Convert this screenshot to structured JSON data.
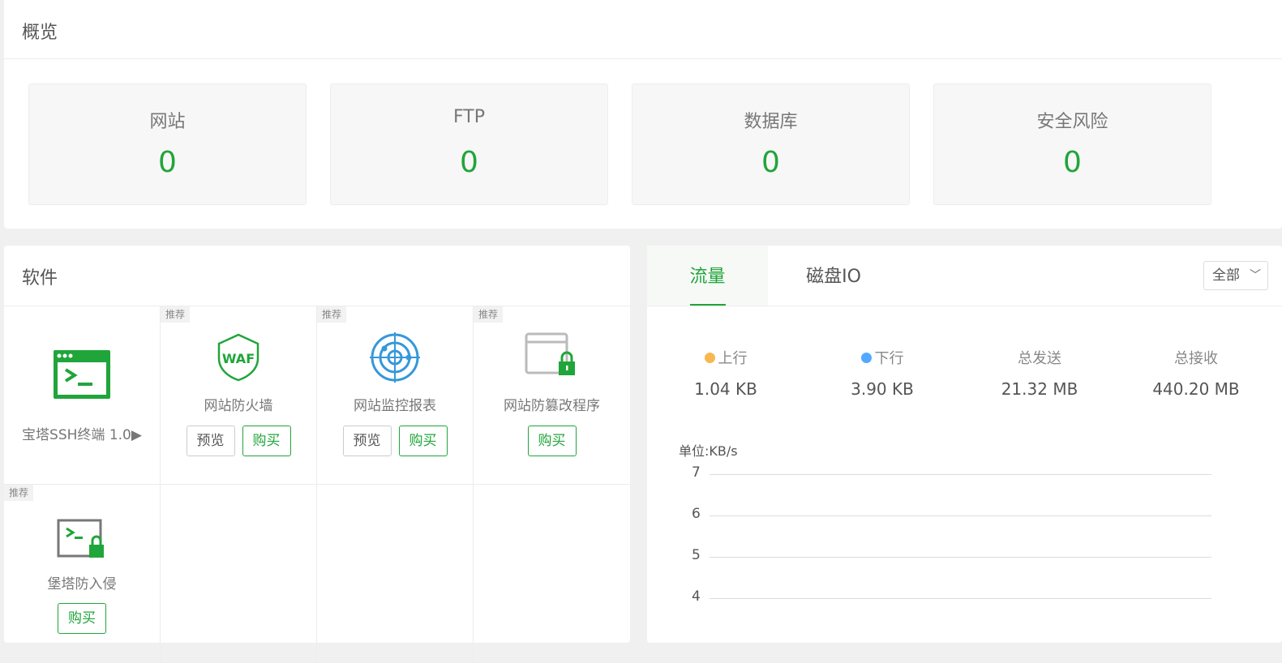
{
  "overview": {
    "title": "概览",
    "stats": [
      {
        "label": "网站",
        "value": "0"
      },
      {
        "label": "FTP",
        "value": "0"
      },
      {
        "label": "数据库",
        "value": "0"
      },
      {
        "label": "安全风险",
        "value": "0"
      }
    ]
  },
  "software": {
    "title": "软件",
    "items": [
      {
        "name": "宝塔SSH终端 1.0▶",
        "tag": "",
        "icon": "terminal-icon"
      },
      {
        "name": "网站防火墙",
        "tag": "推荐",
        "icon": "waf-shield-icon",
        "preview": "预览",
        "buy": "购买"
      },
      {
        "name": "网站监控报表",
        "tag": "推荐",
        "icon": "radar-icon",
        "preview": "预览",
        "buy": "购买"
      },
      {
        "name": "网站防篡改程序",
        "tag": "推荐",
        "icon": "browser-lock-icon",
        "buy": "购买"
      },
      {
        "name": "堡塔防入侵",
        "tag": "推荐",
        "icon": "terminal-lock-icon",
        "buy": "购买"
      }
    ]
  },
  "traffic": {
    "tabs": [
      "流量",
      "磁盘IO"
    ],
    "active_tab": "流量",
    "filter": "全部",
    "stats": [
      {
        "label": "上行",
        "value": "1.04 KB",
        "color": "#f7b851"
      },
      {
        "label": "下行",
        "value": "3.90 KB",
        "color": "#52a9ff"
      },
      {
        "label": "总发送",
        "value": "21.32 MB"
      },
      {
        "label": "总接收",
        "value": "440.20 MB"
      }
    ],
    "unit": "单位:KB/s",
    "y_ticks": [
      "7",
      "6",
      "5",
      "4"
    ]
  },
  "colors": {
    "accent": "#20a53a",
    "up": "#f7b851",
    "down": "#52a9ff"
  }
}
